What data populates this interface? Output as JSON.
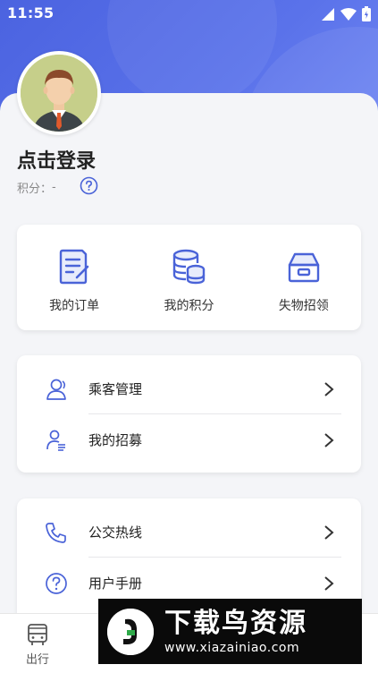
{
  "status_bar": {
    "time": "11:55"
  },
  "profile": {
    "login_text": "点击登录",
    "points_label": "积分：",
    "points_value": "-"
  },
  "quick_actions": [
    {
      "label": "我的订单",
      "icon": "order-document-icon"
    },
    {
      "label": "我的积分",
      "icon": "coins-stack-icon"
    },
    {
      "label": "失物招领",
      "icon": "lost-found-box-icon"
    }
  ],
  "menu_group1": [
    {
      "label": "乘客管理",
      "icon": "passengers-icon"
    },
    {
      "label": "我的招募",
      "icon": "recruit-user-list-icon"
    }
  ],
  "menu_group2": [
    {
      "label": "公交热线",
      "icon": "phone-icon"
    },
    {
      "label": "用户手册",
      "icon": "question-circle-icon"
    }
  ],
  "tabbar": {
    "items": [
      {
        "label": "出行",
        "icon": "bus-icon"
      }
    ]
  },
  "watermark": {
    "title": "下载鸟资源",
    "url": "www.xiazainiao.com"
  },
  "colors": {
    "accent": "#5068e3",
    "icon": "#4a63d8"
  }
}
